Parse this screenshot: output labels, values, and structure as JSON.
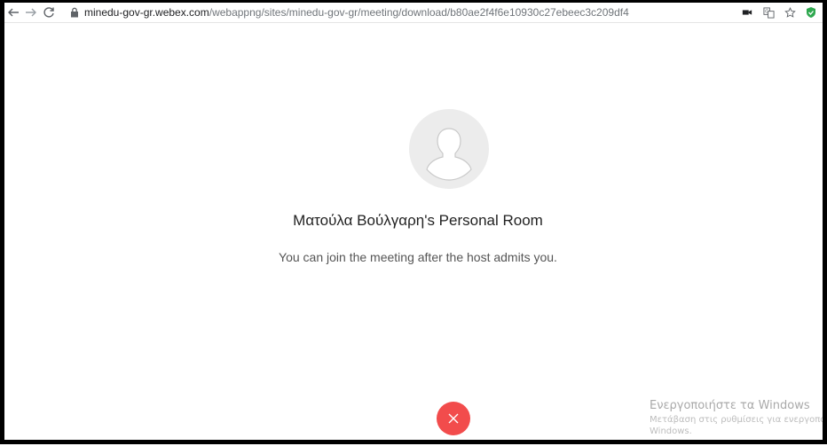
{
  "browser": {
    "url_host": "minedu-gov-gr.webex.com",
    "url_path": "/webappng/sites/minedu-gov-gr/meeting/download/b80ae2f4f6e10930c27ebeec3c209df4"
  },
  "meeting": {
    "title": "Ματούλα Βούλγαρη's Personal Room",
    "message": "You can join the meeting after the host admits you."
  },
  "watermark": {
    "title": "Ενεργοποιήστε τα Windows",
    "line1": "Μετάβαση στις ρυθμίσεις για ενεργοπο",
    "line2": "Windows."
  },
  "colors": {
    "leave_button": "#f24c4c",
    "avatar_bg": "#ececec",
    "extension_badge": "#2fa84f"
  }
}
